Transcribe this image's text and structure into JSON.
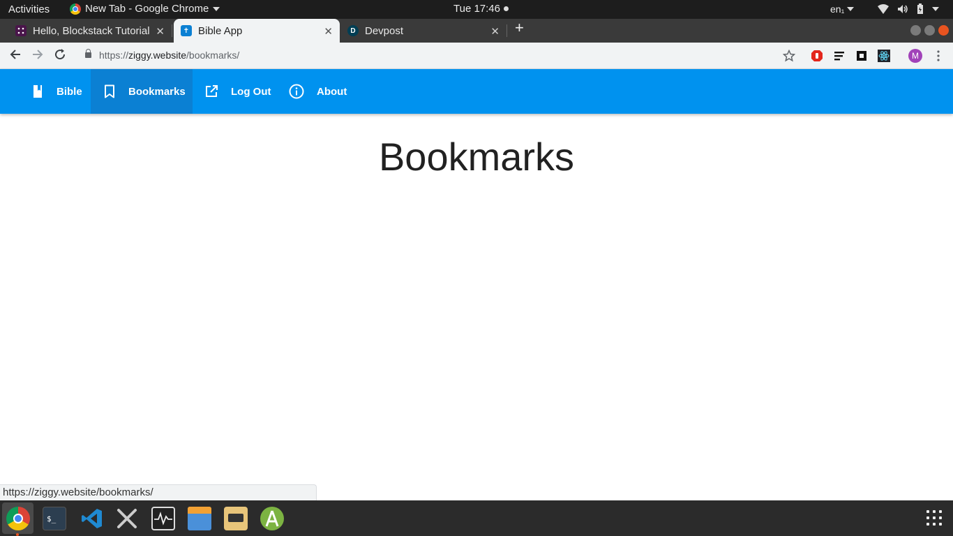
{
  "system_bar": {
    "activities": "Activities",
    "app_menu": "New Tab - Google Chrome",
    "clock": "Tue 17:46",
    "language": "en₁"
  },
  "tabs": [
    {
      "title": "Hello, Blockstack Tutorial",
      "favicon": "slack-icon",
      "active": false
    },
    {
      "title": "Bible App",
      "favicon": "bible-app-icon",
      "active": true
    },
    {
      "title": "Devpost",
      "favicon": "devpost-icon",
      "active": false
    }
  ],
  "address_bar": {
    "url_scheme": "https://",
    "url_host": "ziggy.website",
    "url_path": "/bookmarks/"
  },
  "profile_initial": "M",
  "app_nav": {
    "items": [
      {
        "label": "Bible",
        "icon": "book-icon"
      },
      {
        "label": "Bookmarks",
        "icon": "bookmark-icon"
      },
      {
        "label": "Log Out",
        "icon": "external-link-icon"
      },
      {
        "label": "About",
        "icon": "info-icon"
      }
    ],
    "active": "Bookmarks",
    "color": "#0092ef",
    "active_color": "#0b80d3"
  },
  "page": {
    "title": "Bookmarks"
  },
  "status_bubble": "https://ziggy.website/bookmarks/"
}
